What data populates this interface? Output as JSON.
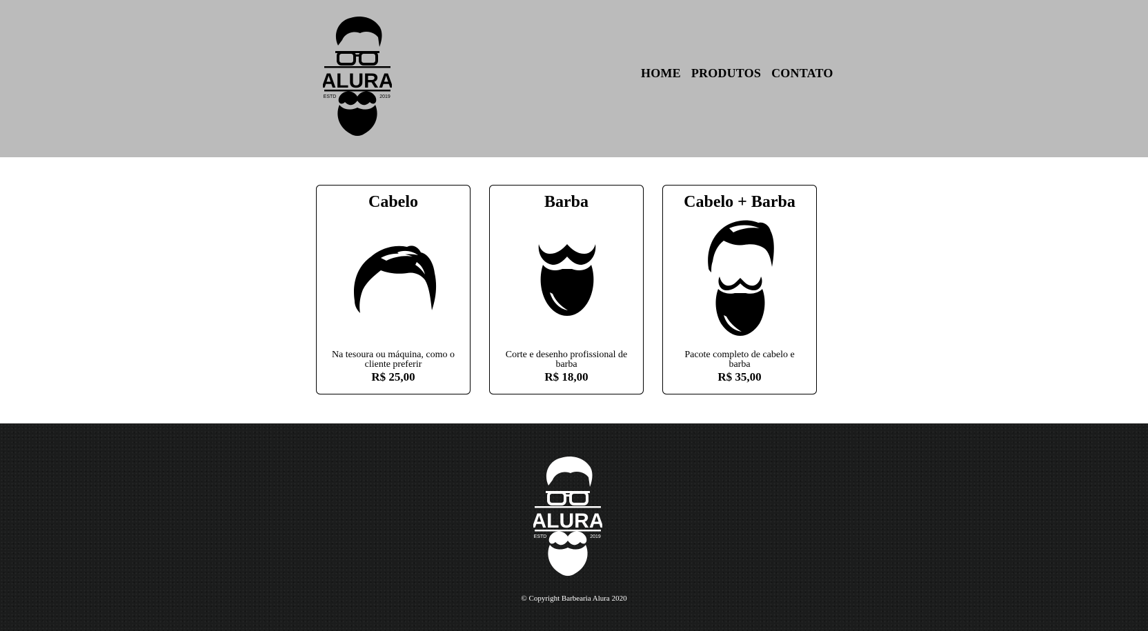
{
  "header": {
    "logo": {
      "text": "ALURA",
      "estd": "ESTD",
      "year": "2019"
    },
    "nav": [
      "HOME",
      "PRODUTOS",
      "CONTATO"
    ]
  },
  "products": [
    {
      "title": "Cabelo",
      "icon": "hair-icon",
      "description": "Na tesoura ou máquina, como o cliente preferir",
      "price": "R$ 25,00"
    },
    {
      "title": "Barba",
      "icon": "beard-icon",
      "description": "Corte e desenho profissional de barba",
      "price": "R$ 18,00"
    },
    {
      "title": "Cabelo + Barba",
      "icon": "hair-and-beard-icon",
      "description": "Pacote completo de cabelo e barba",
      "price": "R$ 35,00"
    }
  ],
  "footer": {
    "logo": {
      "text": "ALURA",
      "estd": "ESTD",
      "year": "2019"
    },
    "copyright": "© Copyright Barbearia Alura 2020"
  },
  "colors": {
    "header_bg": "#bbbbbb",
    "footer_bg": "#1b1c1c",
    "text": "#000000",
    "footer_text": "#ffffff"
  }
}
